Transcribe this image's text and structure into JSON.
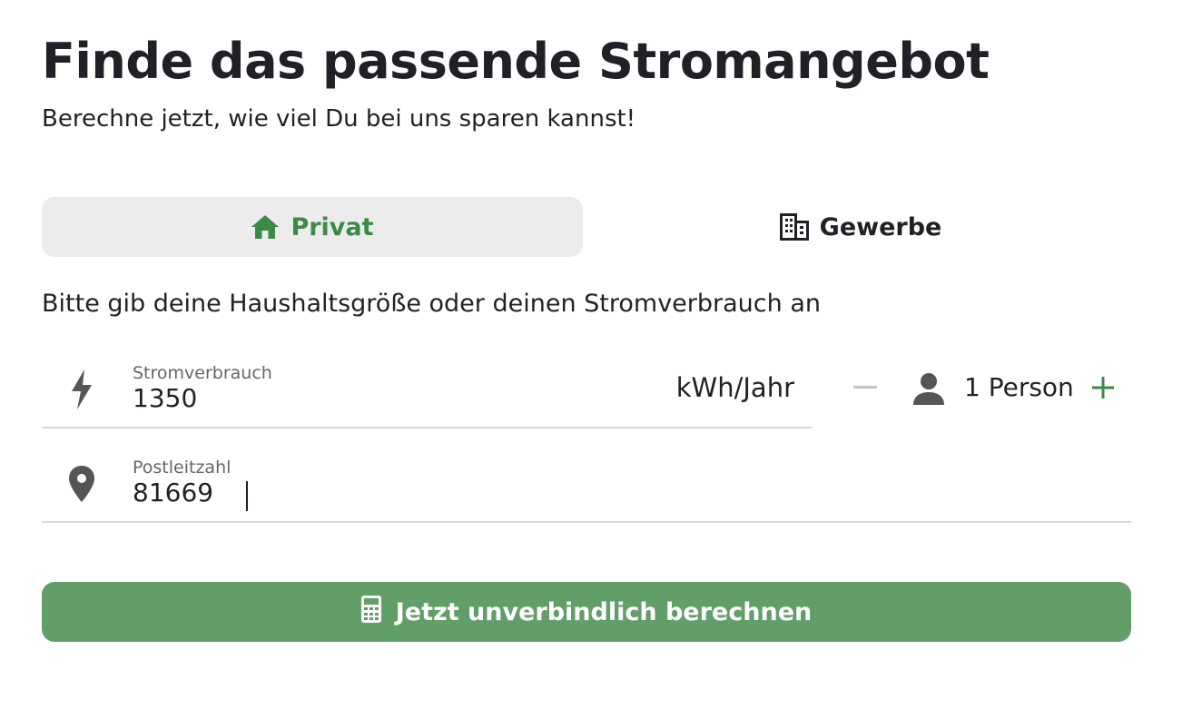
{
  "header": {
    "title": "Finde das passende Stromangebot",
    "subtitle": "Berechne jetzt, wie viel Du bei uns sparen kannst!"
  },
  "tabs": [
    {
      "label": "Privat",
      "icon": "home-icon",
      "active": true
    },
    {
      "label": "Gewerbe",
      "icon": "building-icon",
      "active": false
    }
  ],
  "instruction": "Bitte gib deine Haushaltsgröße oder deinen Stromverbrauch an",
  "consumption": {
    "icon": "lightning-icon",
    "label": "Stromverbrauch",
    "value": "1350",
    "unit": "kWh/Jahr"
  },
  "household": {
    "icon": "person-icon",
    "label": "1 Person"
  },
  "zip": {
    "icon": "location-pin-icon",
    "label": "Postleitzahl",
    "value": "81669"
  },
  "submit": {
    "icon": "calculator-icon",
    "label": "Jetzt unverbindlich berechnen"
  },
  "colors": {
    "accent": "#3b8a45",
    "button": "#629e68",
    "tab_active_bg": "#ececec",
    "divider": "#d9d9d9"
  }
}
